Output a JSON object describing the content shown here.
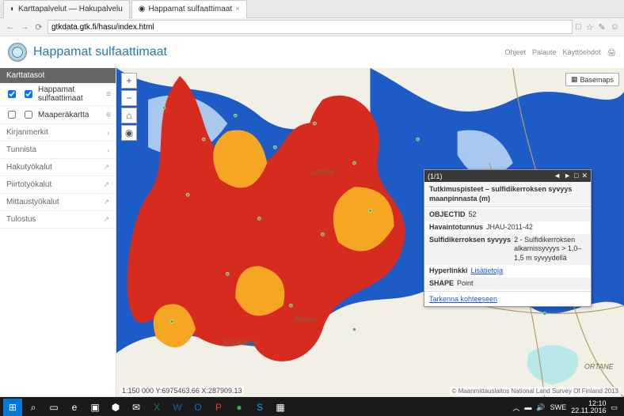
{
  "browser": {
    "tabs": [
      {
        "label": "Karttapalvelut — Hakupalvelu"
      },
      {
        "label": "Happamat sulfaattimaat"
      }
    ],
    "url": "gtkdata.gtk.fi/hasu/index.html",
    "right_icons": [
      "□",
      "☆",
      "✎",
      "☺"
    ]
  },
  "app": {
    "title": "Happamat sulfaattimaat",
    "links": [
      "Ohjeet",
      "Palaute",
      "Käyttöehdot"
    ]
  },
  "sidebar": {
    "head": "Karttatasot",
    "layers": [
      {
        "label": "Happamat sulfaattimaat",
        "checked": true
      },
      {
        "label": "Maaperäkartta",
        "checked": false
      }
    ],
    "items": [
      {
        "label": "Kirjanmerkit",
        "icon": "›"
      },
      {
        "label": "Tunnista",
        "icon": "›"
      },
      {
        "label": "Hakutyökalut",
        "icon": "↗"
      },
      {
        "label": "Piirtotyökalut",
        "icon": "↗"
      },
      {
        "label": "Mittaustyökalut",
        "icon": "↗"
      },
      {
        "label": "Tulostus",
        "icon": "↗"
      }
    ]
  },
  "map": {
    "controls": [
      "+",
      "−",
      "⌂",
      "◉"
    ],
    "basemaps": "Basemaps",
    "scale": "1:150 000  Y:6975463.66  X:287909.13",
    "attrib": "© Maanmittauslaitos National Land Survey Of Finland 2013",
    "places": [
      "LAPUA",
      "Nurmo",
      "KAUHAVA",
      "ORTANE"
    ]
  },
  "popup": {
    "count": "(1/1)",
    "title": "Tutkimuspisteet – sulfidikerroksen syvyys maanpinnasta (m)",
    "rows": [
      {
        "field": "OBJECTID",
        "value": "52"
      },
      {
        "field": "Havaintotunnus",
        "value": "JHAU-2011-42"
      },
      {
        "field": "Sulfidikerroksen syvyys",
        "value": "2 - Sulfidikerroksen alkamissyvyys > 1,0–1,5 m syvyydellä"
      },
      {
        "field": "Hyperlinkki",
        "value": "Lisätietoja",
        "link": true
      },
      {
        "field": "SHAPE",
        "value": "Point"
      }
    ],
    "footer": "Tarkenna kohteeseen"
  },
  "taskbar": {
    "time": "12:10",
    "date": "22.11.2016",
    "lang": "SWE"
  }
}
